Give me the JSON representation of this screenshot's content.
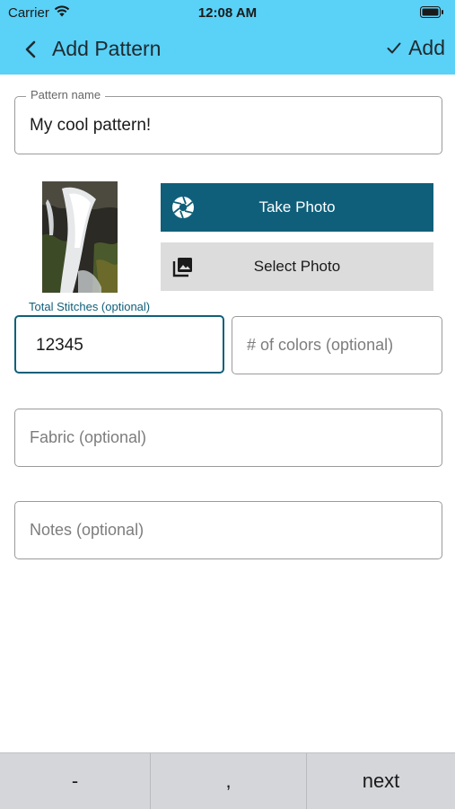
{
  "status": {
    "carrier": "Carrier",
    "time": "12:08 AM"
  },
  "nav": {
    "title": "Add Pattern",
    "add_label": "Add"
  },
  "form": {
    "pattern_name": {
      "label": "Pattern name",
      "value": "My cool pattern!"
    },
    "total_stitches": {
      "label": "Total Stitches (optional)",
      "value": "12345"
    },
    "colors": {
      "placeholder": "# of colors (optional)"
    },
    "fabric": {
      "placeholder": "Fabric (optional)"
    },
    "notes": {
      "placeholder": "Notes (optional)"
    }
  },
  "photo_buttons": {
    "take": "Take Photo",
    "select": "Select Photo"
  },
  "keyboard_bar": {
    "keys": [
      "-",
      ",",
      "next"
    ]
  },
  "colors": {
    "header": "#5ad1f7",
    "primary": "#0f5f7a",
    "secondary_button": "#dcdcdc"
  },
  "icons": [
    "wifi-icon",
    "battery-icon",
    "back-chevron-icon",
    "checkmark-icon",
    "camera-shutter-icon",
    "photo-library-icon"
  ]
}
